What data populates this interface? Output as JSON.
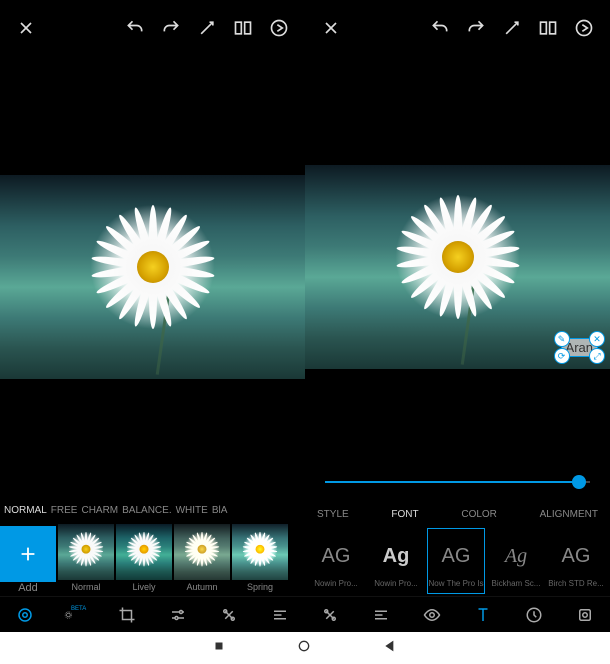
{
  "left": {
    "toolbar_icons": [
      "close",
      "undo",
      "redo",
      "wand",
      "compare",
      "apply"
    ],
    "filter_categories": [
      "NORMAL",
      "FREE",
      "CHARM",
      "BALANCE.",
      "WHITE",
      "BlA"
    ],
    "add_label": "Add",
    "filters": [
      {
        "label": "Normal"
      },
      {
        "label": "Lively"
      },
      {
        "label": "Autumn"
      },
      {
        "label": "Spring"
      }
    ],
    "tools": [
      "adjust",
      "effects",
      "crop",
      "tune",
      "heal",
      "text-settings"
    ]
  },
  "right": {
    "toolbar_icons": [
      "close",
      "undo",
      "redo",
      "wand",
      "compare",
      "apply"
    ],
    "text_overlay": "Aran",
    "text_tabs": [
      "STYLE",
      "FONT",
      "COLOR",
      "ALIGNMENT"
    ],
    "text_tab_selected": "FONT",
    "fonts": [
      {
        "sample": "AG",
        "name": "Nowin Pro...",
        "style": "normal"
      },
      {
        "sample": "Ag",
        "name": "Nowin Pro...",
        "style": "bold"
      },
      {
        "sample": "AG",
        "name": "Now The Pro Is",
        "style": "normal",
        "selected": true
      },
      {
        "sample": "Ag",
        "name": "Bickham Sc...",
        "style": "italic script"
      },
      {
        "sample": "AG",
        "name": "Birch STD Re...",
        "style": "normal"
      }
    ],
    "tools": [
      "heal",
      "text-settings",
      "visibility",
      "text",
      "time",
      "layers"
    ]
  },
  "nav": [
    "stop",
    "circle",
    "back"
  ]
}
